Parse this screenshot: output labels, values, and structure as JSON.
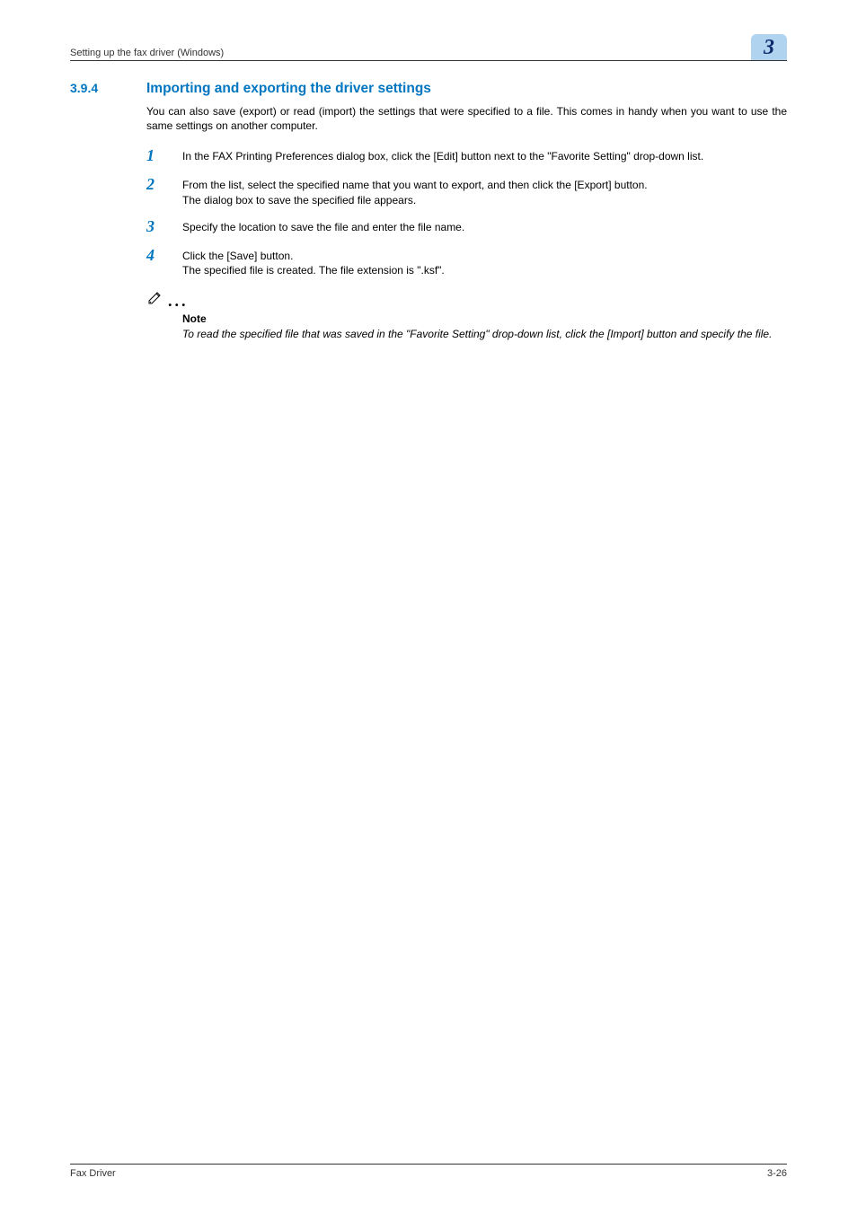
{
  "header": {
    "breadcrumb": "Setting up the fax driver (Windows)",
    "chapter_number": "3"
  },
  "section": {
    "number": "3.9.4",
    "title": "Importing and exporting the driver settings"
  },
  "intro": "You can also save (export) or read (import) the settings that were specified to a file. This comes in handy when you want to use the same settings on another computer.",
  "steps": [
    {
      "num": "1",
      "text": "In the FAX Printing Preferences dialog box, click the [Edit] button next to the \"Favorite Setting\" drop-down list.",
      "followup": ""
    },
    {
      "num": "2",
      "text": "From the list, select the specified name that you want to export, and then click the [Export] button.",
      "followup": "The dialog box to save the specified file appears."
    },
    {
      "num": "3",
      "text": "Specify the location to save the file and enter the file name.",
      "followup": ""
    },
    {
      "num": "4",
      "text": "Click the [Save] button.",
      "followup": "The specified file is created. The file extension is \".ksf\"."
    }
  ],
  "note": {
    "label": "Note",
    "body": "To read the specified file that was saved in the \"Favorite Setting\" drop-down list, click the [Import] button and specify the file."
  },
  "footer": {
    "left": "Fax Driver",
    "right": "3-26"
  }
}
